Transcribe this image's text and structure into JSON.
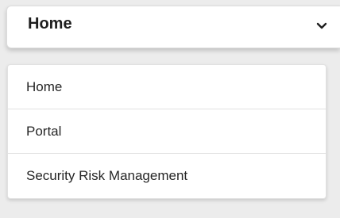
{
  "select": {
    "value": "Home",
    "icon": "chevron-down-icon"
  },
  "dropdown": {
    "options": [
      {
        "label": "Home"
      },
      {
        "label": "Portal"
      },
      {
        "label": "Security Risk Management"
      }
    ]
  },
  "colors": {
    "background": "#ececec",
    "surface": "#ffffff",
    "text": "#1e1e1e",
    "divider": "#e2e2e2"
  }
}
